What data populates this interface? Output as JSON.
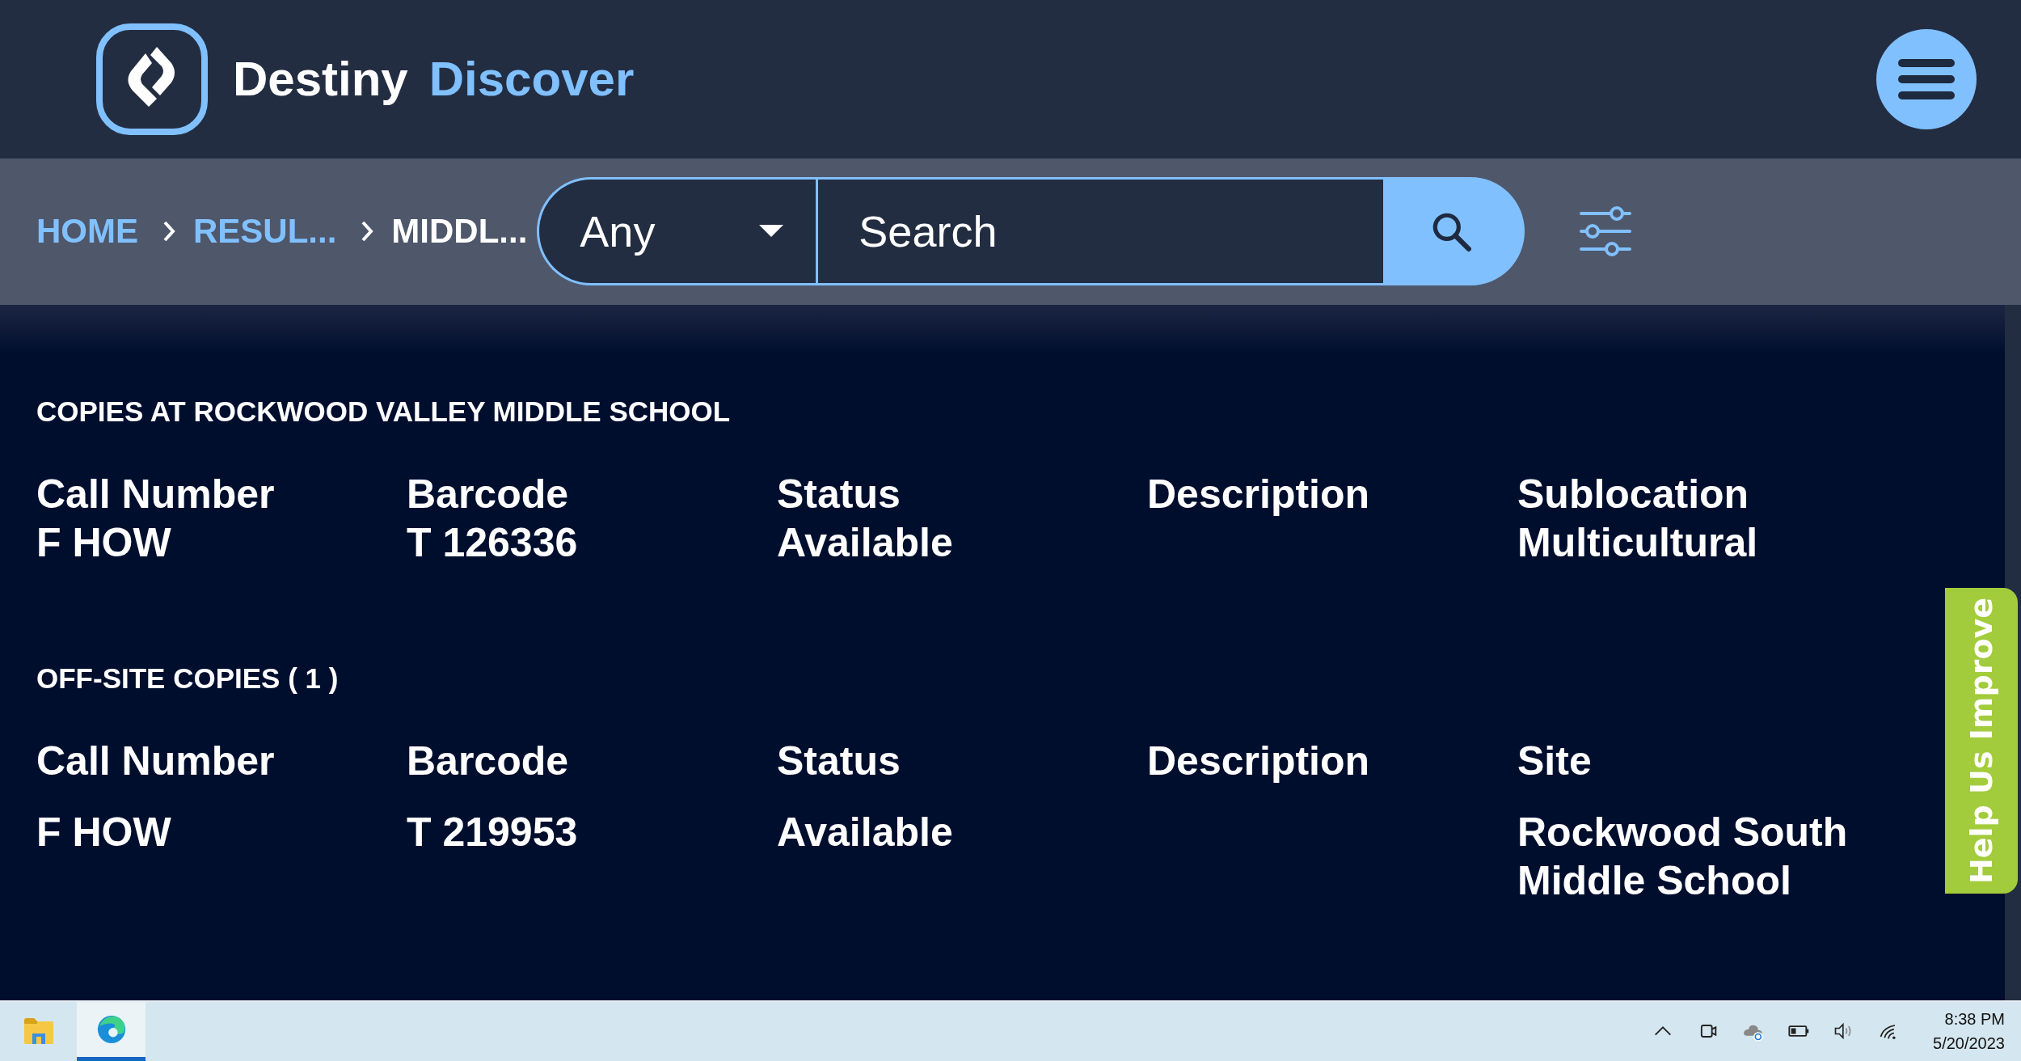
{
  "header": {
    "brand_first": "Destiny",
    "brand_second": "Discover"
  },
  "breadcrumbs": [
    {
      "label": "HOME",
      "current": false
    },
    {
      "label": "RESUL...",
      "current": false
    },
    {
      "label": "MIDDL...",
      "current": true
    }
  ],
  "search": {
    "scope": "Any",
    "placeholder": "Search"
  },
  "sections": [
    {
      "title": "COPIES AT ROCKWOOD VALLEY MIDDLE SCHOOL",
      "columns": [
        {
          "header": "Call Number",
          "lines": [
            "F HOW"
          ]
        },
        {
          "header": "Barcode",
          "lines": [
            "T 126336"
          ]
        },
        {
          "header": "Status",
          "lines": [
            "Available"
          ]
        },
        {
          "header": "Description"
        },
        {
          "header": "Sublocation",
          "lines": [
            "Multicultural"
          ]
        }
      ]
    },
    {
      "title": "OFF-SITE COPIES ( 1 )",
      "columns": [
        {
          "header": "Call Number",
          "lines": [
            "F HOW"
          ]
        },
        {
          "header": "Barcode",
          "lines": [
            "T 219953"
          ]
        },
        {
          "header": "Status",
          "lines": [
            "Available"
          ]
        },
        {
          "header": "Description"
        },
        {
          "header": "Site",
          "lines": [
            "Rockwood South Middle School"
          ]
        }
      ]
    }
  ],
  "help_tab": "Help Us Improve",
  "taskbar": {
    "apps": [
      {
        "kind": "files",
        "selected": false
      },
      {
        "kind": "browser",
        "selected": true
      }
    ],
    "time": "8:38 PM",
    "date": "5/20/2023"
  }
}
